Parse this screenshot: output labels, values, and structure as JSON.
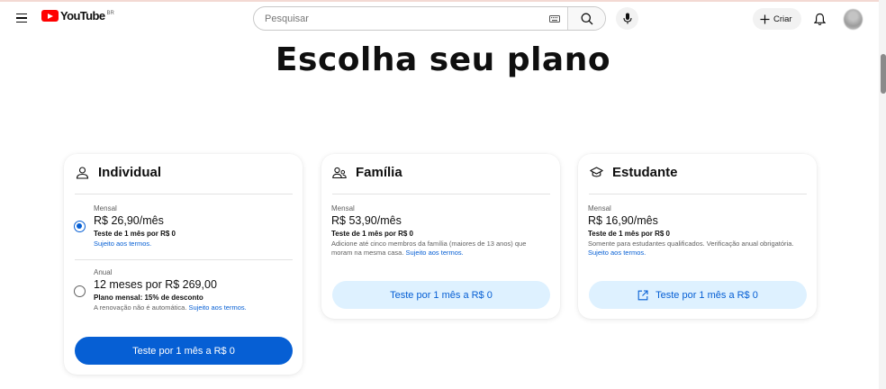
{
  "header": {
    "logo_text": "YouTube",
    "country_code": "BR",
    "search_placeholder": "Pesquisar",
    "create_label": "Criar"
  },
  "page": {
    "title": "Escolha seu plano"
  },
  "plans": {
    "individual": {
      "title": "Individual",
      "icon": "person-icon",
      "options": [
        {
          "label": "Mensal",
          "price": "R$ 26,90/mês",
          "trial": "Teste de 1 mês por R$ 0",
          "terms_link": "Sujeito aos termos.",
          "selected": true
        },
        {
          "label": "Anual",
          "price": "12 meses por R$ 269,00",
          "trial": "Plano mensal: 15% de desconto",
          "note": "A renovação não é automática.",
          "terms_link": "Sujeito aos termos.",
          "selected": false
        }
      ],
      "cta": "Teste por 1 mês a R$ 0"
    },
    "familia": {
      "title": "Família",
      "icon": "family-icon",
      "label": "Mensal",
      "price": "R$ 53,90/mês",
      "trial": "Teste de 1 mês por R$ 0",
      "note": "Adicione até cinco membros da família (maiores de 13 anos) que moram na mesma casa.",
      "terms_link": "Sujeito aos termos.",
      "cta": "Teste por 1 mês a R$ 0"
    },
    "estudante": {
      "title": "Estudante",
      "icon": "graduation-cap-icon",
      "label": "Mensal",
      "price": "R$ 16,90/mês",
      "trial": "Teste de 1 mês por R$ 0",
      "note": "Somente para estudantes qualificados. Verificação anual obrigatória.",
      "terms_link": "Sujeito aos termos.",
      "cta": "Teste por 1 mês a R$ 0"
    }
  },
  "colors": {
    "brand_red": "#ff0000",
    "primary_blue": "#065fd4",
    "secondary_button_bg": "#def1ff"
  }
}
